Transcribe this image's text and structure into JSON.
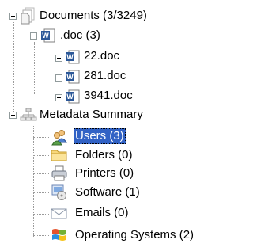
{
  "tree": {
    "documents": {
      "label": "Documents (3/3249)",
      "icon": "documents-stack-icon",
      "children": {
        "doc_group": {
          "label": ".doc (3)",
          "icon": "word-document-icon",
          "files": [
            "22.doc",
            "281.doc",
            "3941.doc"
          ]
        }
      }
    },
    "metadata": {
      "label": "Metadata Summary",
      "icon": "network-tree-icon",
      "items": [
        {
          "label": "Users (3)",
          "icon": "users-icon",
          "selected": true
        },
        {
          "label": "Folders (0)",
          "icon": "folder-icon",
          "selected": false
        },
        {
          "label": "Printers (0)",
          "icon": "printer-icon",
          "selected": false
        },
        {
          "label": "Software (1)",
          "icon": "software-icon",
          "selected": false
        },
        {
          "label": "Emails (0)",
          "icon": "email-icon",
          "selected": false
        },
        {
          "label": "Operating Systems (2)",
          "icon": "windows-logo-icon",
          "selected": false
        }
      ]
    }
  },
  "colors": {
    "selection": "#3162c5",
    "connector": "#9a9a9a",
    "expander_border": "#919b9c",
    "word_blue": "#2b5797"
  }
}
